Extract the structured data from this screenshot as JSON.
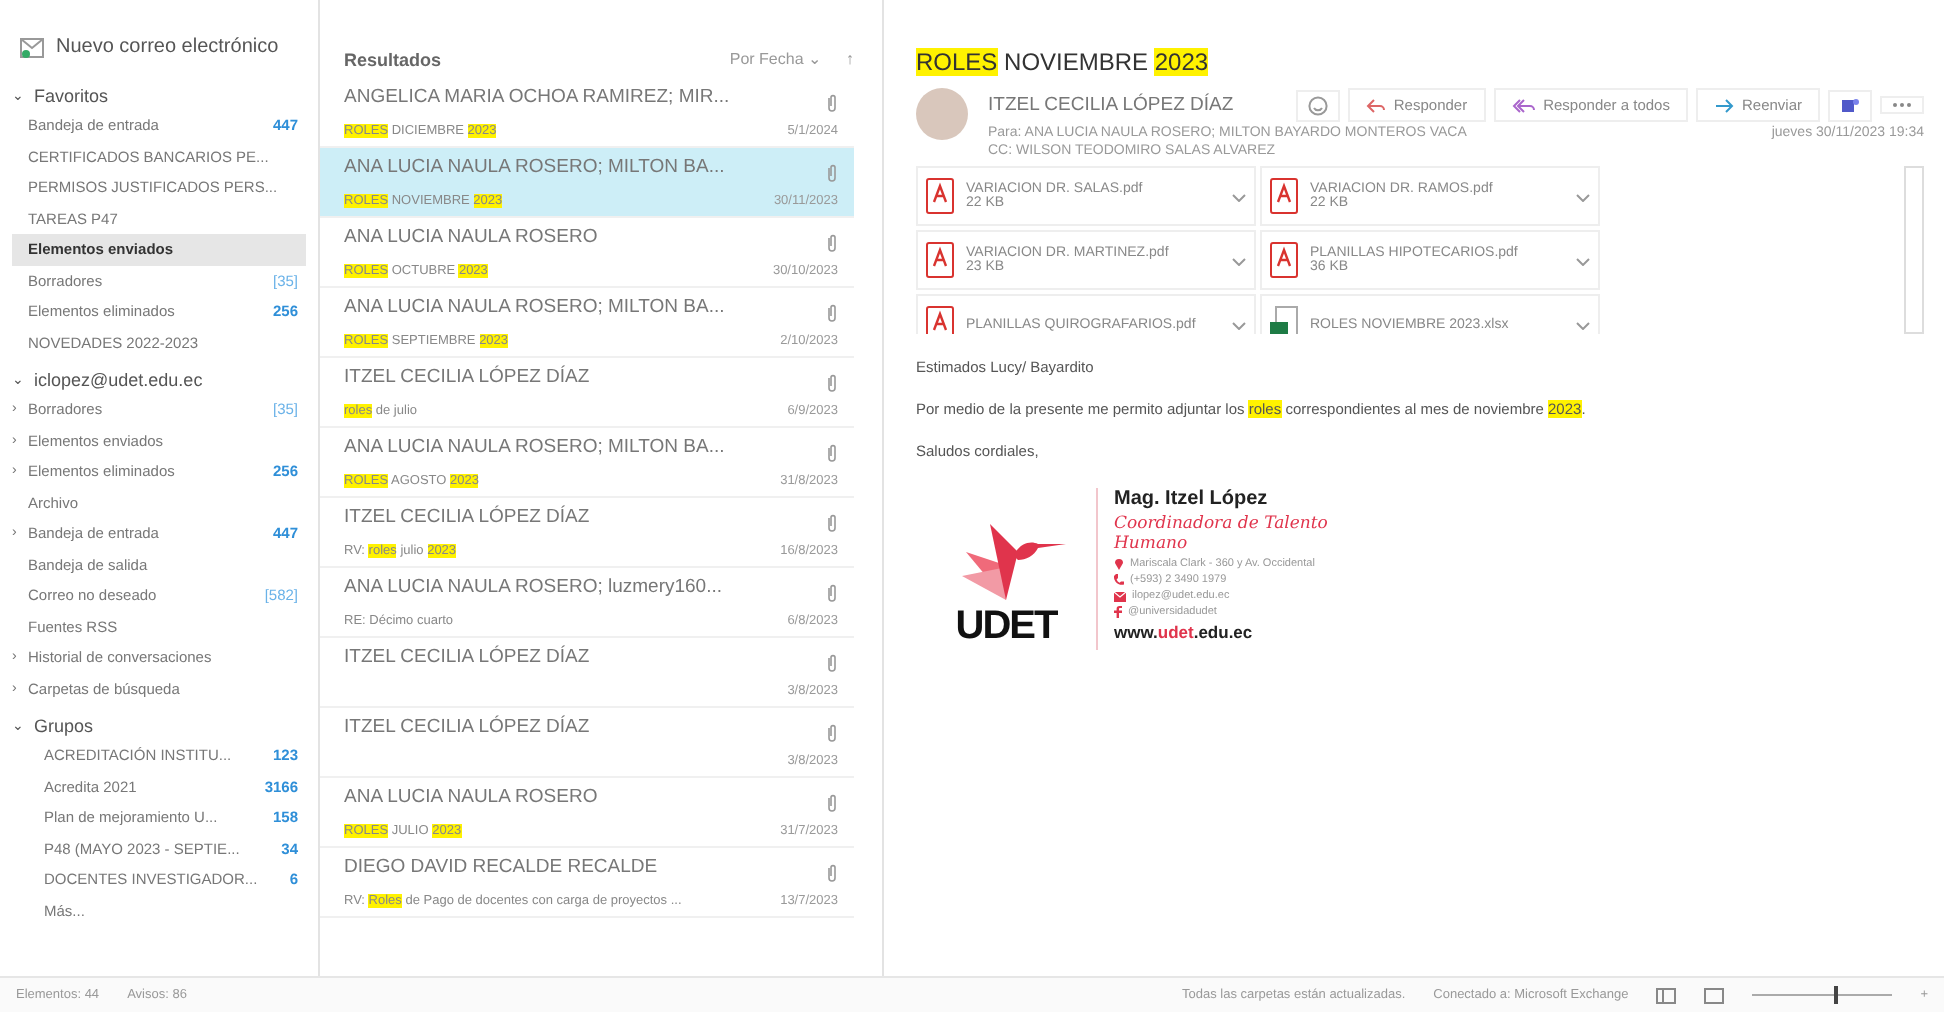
{
  "new_mail": "Nuevo correo electrónico",
  "nav_sections": [
    {
      "title": "Favoritos",
      "chevron": "⌄",
      "indented": false,
      "items": [
        {
          "label": "Bandeja de entrada",
          "count": "447",
          "unread": true,
          "selected": false
        },
        {
          "label": "CERTIFICADOS BANCARIOS PE...",
          "selected": false
        },
        {
          "label": "PERMISOS JUSTIFICADOS PERS...",
          "selected": false
        },
        {
          "label": "TAREAS P47",
          "selected": false
        },
        {
          "label": "Elementos enviados",
          "selected": true
        },
        {
          "label": "Borradores",
          "count": "[35]",
          "unread": false,
          "selected": false
        },
        {
          "label": "Elementos eliminados",
          "count": "256",
          "unread": true,
          "selected": false
        },
        {
          "label": "NOVEDADES 2022-2023",
          "selected": false
        }
      ]
    },
    {
      "title": "iclopez@udet.edu.ec",
      "chevron": "⌄",
      "indented": false,
      "items": [
        {
          "label": "Borradores",
          "chevron": "›",
          "count": "[35]",
          "unread": false,
          "selected": false
        },
        {
          "label": "Elementos enviados",
          "chevron": "›",
          "selected": false
        },
        {
          "label": "Elementos eliminados",
          "chevron": "›",
          "count": "256",
          "unread": true,
          "selected": false
        },
        {
          "label": "Archivo",
          "selected": false
        },
        {
          "label": "Bandeja de entrada",
          "chevron": "›",
          "count": "447",
          "unread": true,
          "selected": false
        },
        {
          "label": "Bandeja de salida",
          "selected": false
        },
        {
          "label": "Correo no deseado",
          "count": "[582]",
          "unread": false,
          "selected": false
        },
        {
          "label": "Fuentes RSS",
          "selected": false
        },
        {
          "label": "Historial de conversaciones",
          "chevron": "›",
          "selected": false
        },
        {
          "label": "Carpetas de búsqueda",
          "chevron": "›",
          "selected": false
        }
      ]
    },
    {
      "title": "Grupos",
      "chevron": "⌄",
      "indented": true,
      "items": [
        {
          "label": "ACREDITACIÓN INSTITU...",
          "count": "123",
          "unread": true,
          "selected": false
        },
        {
          "label": "Acredita 2021",
          "count": "3166",
          "unread": true,
          "selected": false
        },
        {
          "label": "Plan de mejoramiento U...",
          "count": "158",
          "unread": true,
          "selected": false
        },
        {
          "label": "P48 (MAYO 2023 - SEPTIE...",
          "count": "34",
          "unread": true,
          "selected": false
        },
        {
          "label": "DOCENTES INVESTIGADOR...",
          "count": "6",
          "unread": true,
          "selected": false
        },
        {
          "label": "Más...",
          "selected": false
        }
      ]
    }
  ],
  "list": {
    "title": "Resultados",
    "sort": "Por Fecha",
    "sort_caret": "⌄",
    "sort_arrow": "↑",
    "rows": [
      {
        "sender": "ANGELICA MARIA OCHOA RAMIREZ; MIR...",
        "subject": [
          {
            "text": "ROLES",
            "hl": true
          },
          {
            "text": " DICIEMBRE ",
            "hl": false
          },
          {
            "text": "2023",
            "hl": true
          }
        ],
        "date": "5/1/2024",
        "selected": false
      },
      {
        "sender": "ANA LUCIA NAULA ROSERO; MILTON BA...",
        "subject": [
          {
            "text": "ROLES",
            "hl": true
          },
          {
            "text": " NOVIEMBRE ",
            "hl": false
          },
          {
            "text": "2023",
            "hl": true
          }
        ],
        "date": "30/11/2023",
        "selected": true
      },
      {
        "sender": "ANA LUCIA NAULA ROSERO",
        "subject": [
          {
            "text": "ROLES",
            "hl": true
          },
          {
            "text": " OCTUBRE ",
            "hl": false
          },
          {
            "text": "2023",
            "hl": true
          }
        ],
        "date": "30/10/2023",
        "selected": false
      },
      {
        "sender": "ANA LUCIA NAULA ROSERO; MILTON BA...",
        "subject": [
          {
            "text": "ROLES",
            "hl": true
          },
          {
            "text": " SEPTIEMBRE ",
            "hl": false
          },
          {
            "text": "2023",
            "hl": true
          }
        ],
        "date": "2/10/2023",
        "selected": false
      },
      {
        "sender": "ITZEL CECILIA LÓPEZ DÍAZ",
        "subject": [
          {
            "text": "roles",
            "hl": true
          },
          {
            "text": " de julio",
            "hl": false
          }
        ],
        "date": "6/9/2023",
        "selected": false
      },
      {
        "sender": "ANA LUCIA NAULA ROSERO; MILTON BA...",
        "subject": [
          {
            "text": "ROLES",
            "hl": true
          },
          {
            "text": " AGOSTO ",
            "hl": false
          },
          {
            "text": "2023",
            "hl": true
          }
        ],
        "date": "31/8/2023",
        "selected": false
      },
      {
        "sender": "ITZEL CECILIA LÓPEZ DÍAZ",
        "subject": [
          {
            "text": "RV: ",
            "hl": false
          },
          {
            "text": "roles",
            "hl": true
          },
          {
            "text": " julio ",
            "hl": false
          },
          {
            "text": "2023",
            "hl": true
          }
        ],
        "date": "16/8/2023",
        "selected": false
      },
      {
        "sender": "ANA LUCIA NAULA ROSERO; luzmery160...",
        "subject": [
          {
            "text": "RE: Décimo cuarto",
            "hl": false
          }
        ],
        "date": "6/8/2023",
        "selected": false
      },
      {
        "sender": "ITZEL CECILIA LÓPEZ DÍAZ",
        "subject": [],
        "date": "3/8/2023",
        "selected": false
      },
      {
        "sender": "ITZEL CECILIA LÓPEZ DÍAZ",
        "subject": [],
        "date": "3/8/2023",
        "selected": false
      },
      {
        "sender": "ANA LUCIA NAULA ROSERO",
        "subject": [
          {
            "text": "ROLES",
            "hl": true
          },
          {
            "text": " JULIO ",
            "hl": false
          },
          {
            "text": "2023",
            "hl": true
          }
        ],
        "date": "31/7/2023",
        "selected": false
      },
      {
        "sender": "DIEGO DAVID RECALDE RECALDE",
        "subject": [
          {
            "text": "RV: ",
            "hl": false
          },
          {
            "text": "Roles",
            "hl": true
          },
          {
            "text": " de Pago de docentes con carga de proyectos ...",
            "hl": false
          }
        ],
        "date": "13/7/2023",
        "selected": false
      }
    ]
  },
  "message": {
    "title": [
      {
        "text": "ROLES",
        "hl": true
      },
      {
        "text": " NOVIEMBRE ",
        "hl": false
      },
      {
        "text": "2023",
        "hl": true
      }
    ],
    "from": "ITZEL CECILIA LÓPEZ DÍAZ",
    "to_label": "Para:",
    "to": "ANA LUCIA NAULA ROSERO; MILTON BAYARDO MONTEROS VACA",
    "cc_label": "CC:",
    "cc": "WILSON TEODOMIRO SALAS ALVAREZ",
    "date": "jueves 30/11/2023 19:34",
    "actions": [
      {
        "kind": "reply",
        "label": "Responder"
      },
      {
        "kind": "reply_all",
        "label": "Responder a todos"
      },
      {
        "kind": "forward",
        "label": "Reenviar"
      }
    ],
    "attachments": [
      {
        "kind": "pdf",
        "name": "VARIACION DR. SALAS.pdf",
        "size": "22 KB"
      },
      {
        "kind": "pdf",
        "name": "VARIACION DR. RAMOS.pdf",
        "size": "22 KB"
      },
      {
        "kind": "pdf",
        "name": "VARIACION DR. MARTINEZ.pdf",
        "size": "23 KB"
      },
      {
        "kind": "pdf",
        "name": "PLANILLAS HIPOTECARIOS.pdf",
        "size": "36 KB"
      },
      {
        "kind": "pdf",
        "name": "PLANILLAS QUIROGRAFARIOS.pdf"
      },
      {
        "kind": "xlsx",
        "name": "ROLES NOVIEMBRE 2023.xlsx"
      }
    ],
    "body": [
      [
        {
          "text": "Estimados Lucy/ Bayardito",
          "hl": false
        }
      ],
      [
        {
          "text": "Por medio de la presente me permito adjuntar los ",
          "hl": false
        },
        {
          "text": "roles",
          "hl": true
        },
        {
          "text": " correspondientes al mes de noviembre ",
          "hl": false
        },
        {
          "text": "2023",
          "hl": true
        },
        {
          "text": ".",
          "hl": false
        }
      ],
      [
        {
          "text": "Saludos cordiales,",
          "hl": false
        }
      ]
    ],
    "signature": {
      "logo": "UDET",
      "name": "Mag. Itzel López",
      "role": "Coordinadora de Talento Humano",
      "contacts": [
        {
          "kind": "address",
          "text": "Mariscala Clark - 360 y Av. Occidental"
        },
        {
          "kind": "phone",
          "text": "(+593) 2 3490 1979"
        },
        {
          "kind": "mail",
          "text": "ilopez@udet.edu.ec"
        },
        {
          "kind": "facebook",
          "text": "@universidadudet"
        }
      ],
      "web": [
        {
          "text": "www.",
          "accent": false
        },
        {
          "text": "udet",
          "accent": true
        },
        {
          "text": ".edu.ec",
          "accent": false
        }
      ]
    }
  },
  "status": {
    "left": [
      "Elementos: 44",
      "Avisos: 86"
    ],
    "right": [
      "Todas las carpetas están actualizadas.",
      "Conectado a: Microsoft Exchange"
    ],
    "zoom_slider": {
      "level": 0.6
    },
    "zoom": "+"
  }
}
